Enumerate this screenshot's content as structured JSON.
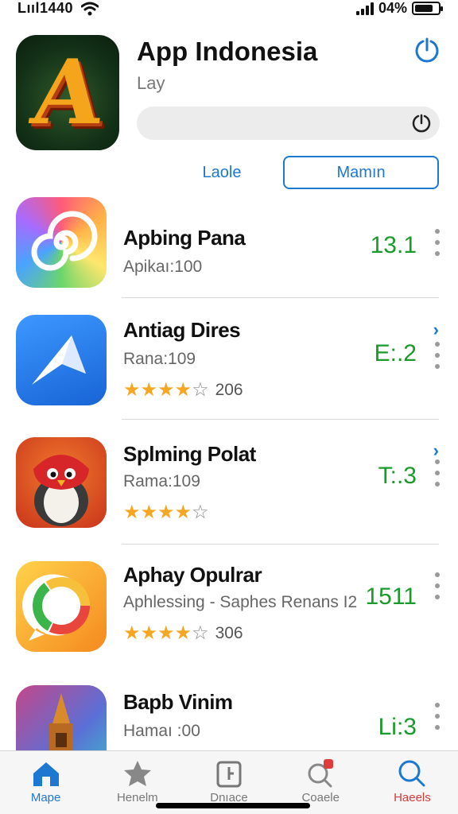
{
  "status_bar": {
    "time": "Lııl1440",
    "battery": "04%",
    "battery_level": 0.8
  },
  "header": {
    "title": "App Indonesia",
    "subtitle": "Lay",
    "search": {
      "value": "",
      "placeholder": ""
    },
    "icon_letter": "A"
  },
  "segments": {
    "left_label": "Laole",
    "right_label": "Mamın"
  },
  "items": [
    {
      "name": "Apbing Pana",
      "sub": "Apikaı:100",
      "value": "13.1",
      "stars": null,
      "rating_count": ""
    },
    {
      "name": "Antiag Dires",
      "sub": "Rana:109",
      "value": "E:.2",
      "stars": 4,
      "rating_count": "206"
    },
    {
      "name": "Splming Polat",
      "sub": "Rama:109",
      "value": "T:.3",
      "stars": 4,
      "rating_count": ""
    },
    {
      "name": "Aphay Opulrar",
      "sub": "Aphlessing - Saphes Renans I2",
      "value": "1511",
      "stars": 4,
      "rating_count": "306"
    },
    {
      "name": "Bapb Vinim",
      "sub": "Hamaı :00",
      "value": "Li:3",
      "stars": null,
      "rating_count": ""
    }
  ],
  "tabs": [
    {
      "label": "Mape",
      "icon": "home-icon"
    },
    {
      "label": "Henelm",
      "icon": "star-icon"
    },
    {
      "label": "Dnıace",
      "icon": "calendar-icon"
    },
    {
      "label": "Coaele",
      "icon": "search-badge-icon"
    },
    {
      "label": "Haeels",
      "icon": "search-icon"
    }
  ],
  "colors": {
    "accent": "#1d78d1",
    "value_green": "#1a9a2b",
    "star": "#f5a623"
  }
}
